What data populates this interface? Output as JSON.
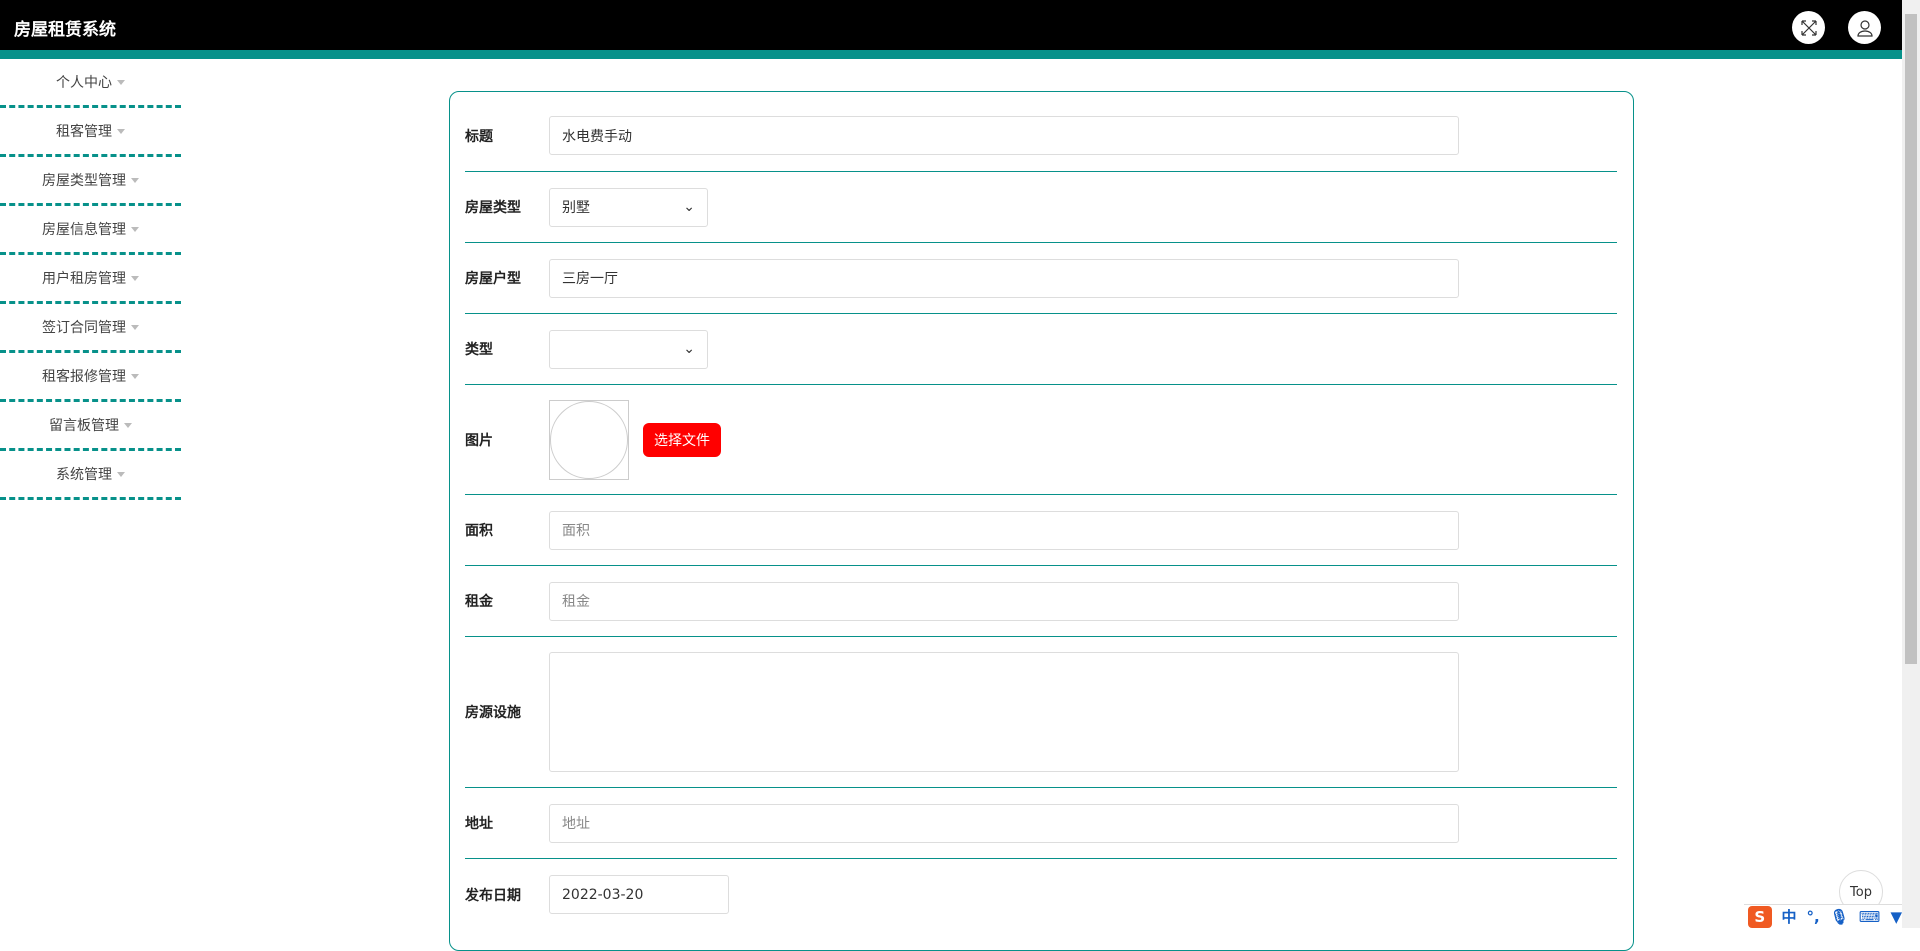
{
  "header": {
    "title": "房屋租赁系统",
    "fullscreen_icon": "expand-icon",
    "user_icon": "user-icon"
  },
  "sidebar": {
    "items": [
      {
        "label": "个人中心"
      },
      {
        "label": "租客管理"
      },
      {
        "label": "房屋类型管理"
      },
      {
        "label": "房屋信息管理"
      },
      {
        "label": "用户租房管理"
      },
      {
        "label": "签订合同管理"
      },
      {
        "label": "租客报修管理"
      },
      {
        "label": "留言板管理"
      },
      {
        "label": "系统管理"
      }
    ]
  },
  "form": {
    "title": {
      "label": "标题",
      "value": "水电费手动"
    },
    "house_type": {
      "label": "房屋类型",
      "value": "别墅"
    },
    "layout": {
      "label": "房屋户型",
      "value": "三房一厅"
    },
    "type": {
      "label": "类型",
      "value": ""
    },
    "image": {
      "label": "图片",
      "button": "选择文件"
    },
    "area": {
      "label": "面积",
      "placeholder": "面积"
    },
    "rent": {
      "label": "租金",
      "placeholder": "租金"
    },
    "facilities": {
      "label": "房源设施",
      "value": ""
    },
    "address": {
      "label": "地址",
      "placeholder": "地址"
    },
    "date": {
      "label": "发布日期",
      "value": "2022-03-20"
    }
  },
  "top_button": "Top",
  "ime": {
    "lang": "中",
    "punct": "°,"
  },
  "colors": {
    "accent": "#07918a",
    "header": "#000000",
    "button": "#ff0000"
  }
}
